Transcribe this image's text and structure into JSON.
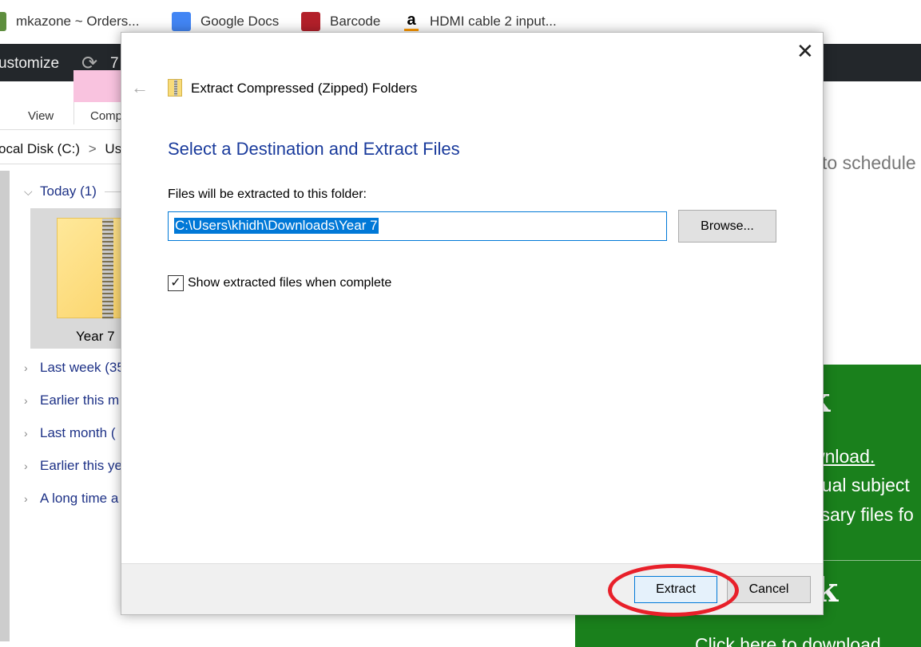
{
  "bookmarks": [
    {
      "label": "mkazone ~ Orders...",
      "icon": "shopify-icon"
    },
    {
      "label": "Google Docs",
      "icon": "google-docs-icon"
    },
    {
      "label": "Barcode",
      "icon": "barcode-icon"
    },
    {
      "label": "HDMI cable 2 input...",
      "icon": "amazon-icon"
    }
  ],
  "darkbar": {
    "customize": "ustomize",
    "updates": "7"
  },
  "explorer": {
    "tabs": {
      "view": "View",
      "comp": "Comp"
    },
    "address": {
      "disk": "ocal Disk (C:)",
      "sep": ">",
      "users": "Use"
    },
    "today": "Today (1)",
    "item": "Year 7",
    "groups": [
      "Last week (35",
      "Earlier this m",
      "Last month (",
      "Earlier this ye",
      "A long time a"
    ]
  },
  "web": {
    "schedule": "to schedule",
    "heading1": "ork",
    "link": "wnload.",
    "line1": "dual subject",
    "line2": "ssary files fo",
    "heading2": "ork",
    "click": "Click here to download",
    "green": "#1a801c"
  },
  "dialog": {
    "title": "Extract Compressed (Zipped) Folders",
    "heading": "Select a Destination and Extract Files",
    "label": "Files will be extracted to this folder:",
    "path": "C:\\Users\\khidh\\Downloads\\Year 7",
    "browse": "Browse...",
    "checkbox_label": "Show extracted files when complete",
    "checkbox_checked": true,
    "extract": "Extract",
    "cancel": "Cancel",
    "close_icon": "close-icon",
    "back_icon": "back-arrow-icon",
    "highlight_color": "#e8202a"
  }
}
